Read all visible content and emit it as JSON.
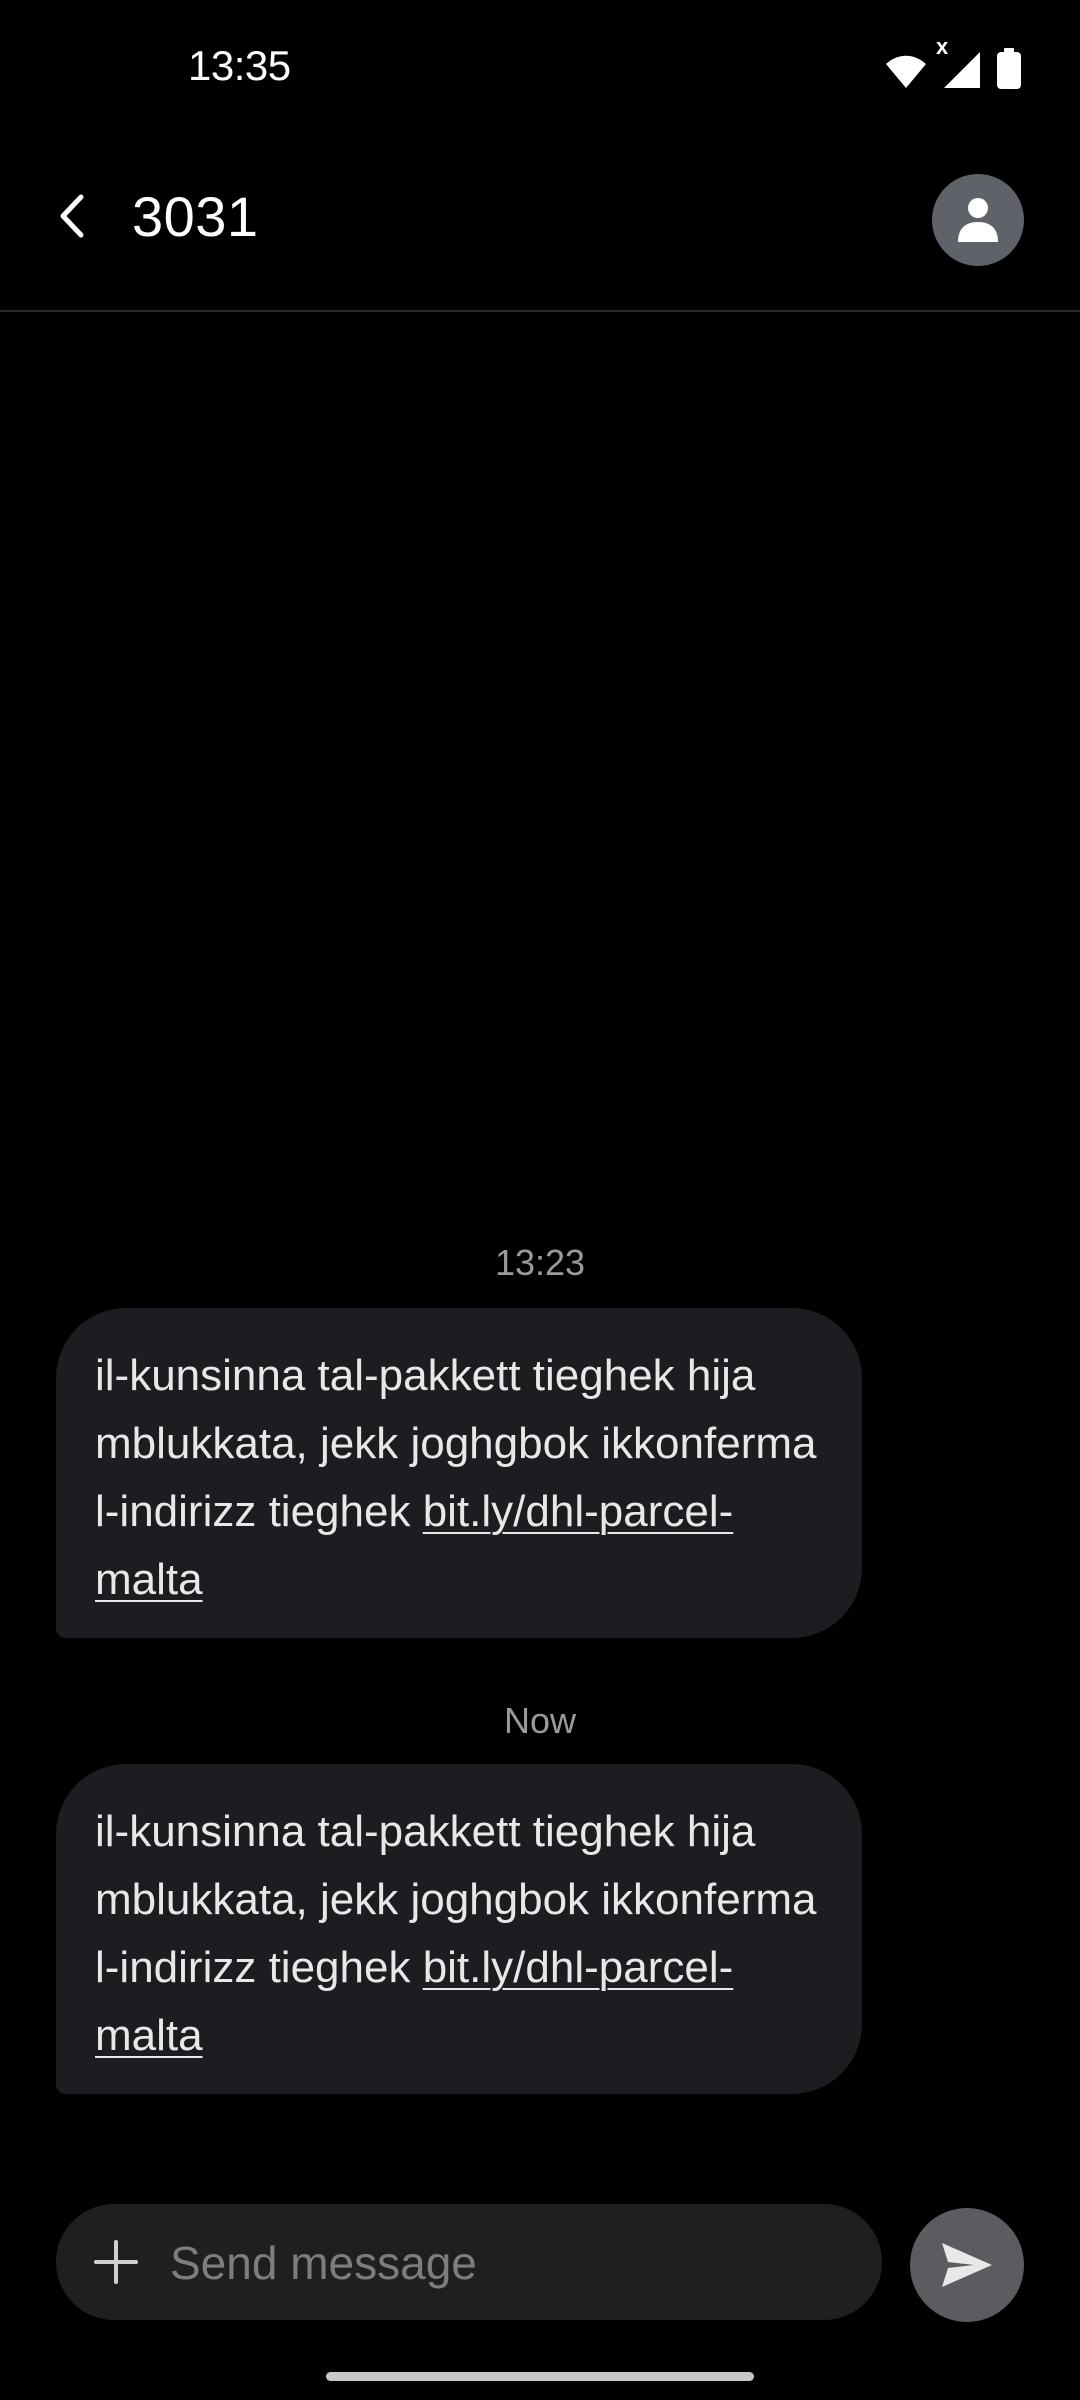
{
  "status_bar": {
    "time": "13:35",
    "icons": [
      "wifi-icon",
      "signal-icon",
      "battery-icon"
    ],
    "signal_marker": "x"
  },
  "header": {
    "title": "3031",
    "back_icon": "chevron-left-icon",
    "avatar_icon": "person-icon"
  },
  "messages": [
    {
      "timestamp": "13:23",
      "text": "il-kunsinna tal-pakkett tieghek hija mblukkata, jekk joghgbok ikkonferma l-indirizz tieghek ",
      "link": "bit.ly/dhl-parcel-malta"
    },
    {
      "timestamp": "Now",
      "text": "il-kunsinna tal-pakkett tieghek hija mblukkata, jekk joghgbok ikkonferma l-indirizz tieghek ",
      "link": "bit.ly/dhl-parcel-malta"
    }
  ],
  "composer": {
    "placeholder": "Send message",
    "value": "",
    "plus_icon": "plus-icon",
    "send_icon": "send-icon"
  },
  "colors": {
    "background": "#000000",
    "bubble": "#1c1d20",
    "composer": "#1f1f1f",
    "send_button": "#5b5c5f",
    "avatar": "#5f6369"
  }
}
